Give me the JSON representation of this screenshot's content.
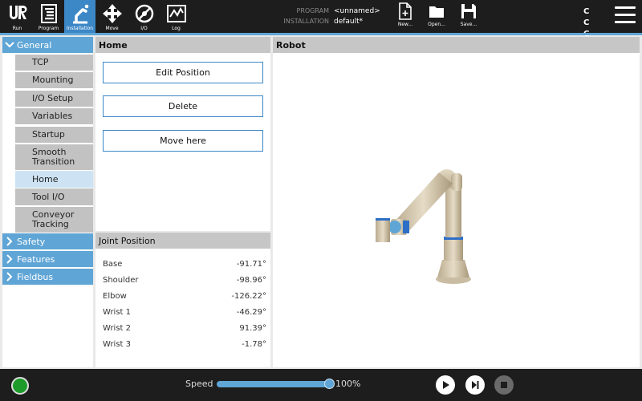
{
  "topbar": {
    "nav": [
      {
        "id": "run",
        "label": "Run",
        "icon": "ur-logo-icon"
      },
      {
        "id": "program",
        "label": "Program",
        "icon": "program-icon"
      },
      {
        "id": "installation",
        "label": "Installation",
        "icon": "installation-icon",
        "active": true
      },
      {
        "id": "move",
        "label": "Move",
        "icon": "move-arrows-icon"
      },
      {
        "id": "io",
        "label": "I/O",
        "icon": "io-gauge-icon"
      },
      {
        "id": "log",
        "label": "Log",
        "icon": "log-chart-icon"
      }
    ],
    "program_key": "PROGRAM",
    "program_value": "<unnamed>",
    "installation_key": "INSTALLATION",
    "installation_value": "default*",
    "file_buttons": [
      {
        "id": "new",
        "label": "New...",
        "icon": "new-file-icon"
      },
      {
        "id": "open",
        "label": "Open...",
        "icon": "folder-icon"
      },
      {
        "id": "save",
        "label": "Save...",
        "icon": "save-icon"
      }
    ],
    "cc_line1": "C C",
    "cc_line2": "C C"
  },
  "sidebar": {
    "general": "General",
    "items": [
      "TCP",
      "Mounting",
      "I/O Setup",
      "Variables",
      "Startup",
      "Smooth Transition",
      "Home",
      "Tool I/O",
      "Conveyor Tracking"
    ],
    "selected": "Home",
    "safety": "Safety",
    "features": "Features",
    "fieldbus": "Fieldbus"
  },
  "home_panel": {
    "title": "Home",
    "edit_label": "Edit Position",
    "delete_label": "Delete",
    "move_label": "Move here"
  },
  "joint_panel": {
    "title": "Joint Position",
    "joints": [
      {
        "name": "Base",
        "value": "-91.71°"
      },
      {
        "name": "Shoulder",
        "value": "-98.96°"
      },
      {
        "name": "Elbow",
        "value": "-126.22°"
      },
      {
        "name": "Wrist 1",
        "value": "-46.29°"
      },
      {
        "name": "Wrist 2",
        "value": "91.39°"
      },
      {
        "name": "Wrist 3",
        "value": "-1.78°"
      }
    ]
  },
  "robot_panel": {
    "title": "Robot"
  },
  "bottombar": {
    "speed_label": "Speed",
    "speed_value": "100%",
    "speed_fraction": 1.0,
    "colors": {
      "accent": "#5fa5d6",
      "power_on": "#1c9b2b"
    }
  }
}
